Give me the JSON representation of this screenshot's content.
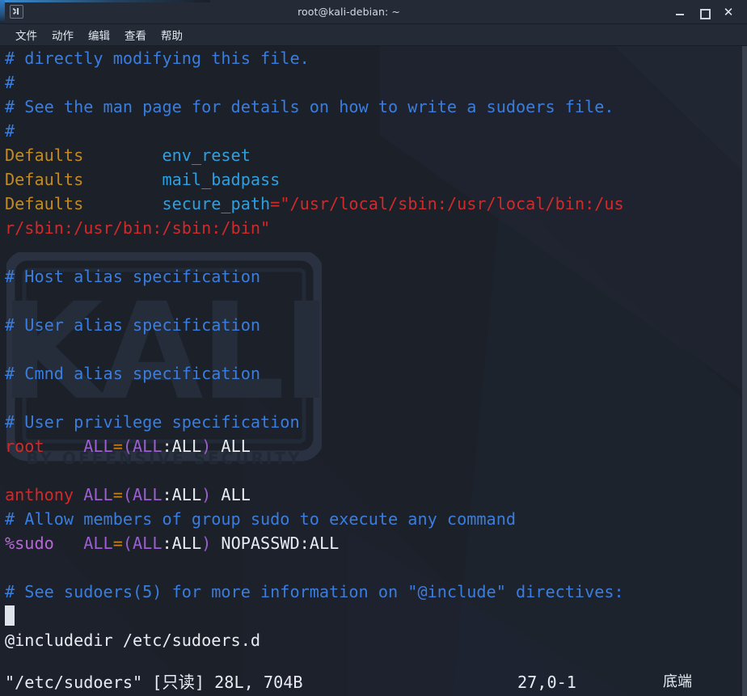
{
  "window": {
    "title": "root@kali-debian: ~",
    "icon": "terminal-icon",
    "controls": {
      "minimize": "—",
      "maximize": "□",
      "close": "✕"
    }
  },
  "menubar": {
    "items": [
      {
        "label": "文件"
      },
      {
        "label": "动作"
      },
      {
        "label": "编辑"
      },
      {
        "label": "查看"
      },
      {
        "label": "帮助"
      }
    ]
  },
  "terminal": {
    "watermark": "KALI",
    "watermark_sub": "BY OFFENSIVE SECURITY",
    "lines": [
      {
        "segments": [
          {
            "text": "# directly modifying this file.",
            "color": "comment"
          }
        ]
      },
      {
        "segments": [
          {
            "text": "#",
            "color": "comment"
          }
        ]
      },
      {
        "segments": [
          {
            "text": "# See the man page for details on how to write a sudoers file.",
            "color": "comment"
          }
        ]
      },
      {
        "segments": [
          {
            "text": "#",
            "color": "comment"
          }
        ]
      },
      {
        "segments": [
          {
            "text": "Defaults",
            "color": "keyword"
          },
          {
            "text": "        ",
            "color": "plain"
          },
          {
            "text": "env_reset",
            "color": "option"
          }
        ]
      },
      {
        "segments": [
          {
            "text": "Defaults",
            "color": "keyword"
          },
          {
            "text": "        ",
            "color": "plain"
          },
          {
            "text": "mail_badpass",
            "color": "option"
          }
        ]
      },
      {
        "segments": [
          {
            "text": "Defaults",
            "color": "keyword"
          },
          {
            "text": "        ",
            "color": "plain"
          },
          {
            "text": "secure_path",
            "color": "option"
          },
          {
            "text": "=",
            "color": "op"
          },
          {
            "text": "\"/usr/local/sbin:/usr/local/bin:/us",
            "color": "string"
          }
        ]
      },
      {
        "segments": [
          {
            "text": "r/sbin:/usr/bin:/sbin:/bin\"",
            "color": "string"
          }
        ]
      },
      {
        "segments": [
          {
            "text": "",
            "color": "plain"
          }
        ]
      },
      {
        "segments": [
          {
            "text": "# Host alias specification",
            "color": "comment"
          }
        ]
      },
      {
        "segments": [
          {
            "text": "",
            "color": "plain"
          }
        ]
      },
      {
        "segments": [
          {
            "text": "# User alias specification",
            "color": "comment"
          }
        ]
      },
      {
        "segments": [
          {
            "text": "",
            "color": "plain"
          }
        ]
      },
      {
        "segments": [
          {
            "text": "# Cmnd alias specification",
            "color": "comment"
          }
        ]
      },
      {
        "segments": [
          {
            "text": "",
            "color": "plain"
          }
        ]
      },
      {
        "segments": [
          {
            "text": "# User privilege specification",
            "color": "comment"
          }
        ]
      },
      {
        "segments": [
          {
            "text": "root",
            "color": "user"
          },
          {
            "text": "    ",
            "color": "plain"
          },
          {
            "text": "ALL",
            "color": "all"
          },
          {
            "text": "=",
            "color": "eq"
          },
          {
            "text": "(ALL",
            "color": "all"
          },
          {
            "text": ":ALL",
            "color": "plain"
          },
          {
            "text": ")",
            "color": "all"
          },
          {
            "text": " ALL",
            "color": "plain"
          }
        ]
      },
      {
        "segments": [
          {
            "text": "",
            "color": "plain"
          }
        ]
      },
      {
        "segments": [
          {
            "text": "anthony",
            "color": "user"
          },
          {
            "text": " ",
            "color": "plain"
          },
          {
            "text": "ALL",
            "color": "all"
          },
          {
            "text": "=",
            "color": "eq"
          },
          {
            "text": "(ALL",
            "color": "all"
          },
          {
            "text": ":ALL",
            "color": "plain"
          },
          {
            "text": ")",
            "color": "all"
          },
          {
            "text": " ALL",
            "color": "plain"
          }
        ]
      },
      {
        "segments": [
          {
            "text": "# Allow members of group sudo to execute any command",
            "color": "comment"
          }
        ]
      },
      {
        "segments": [
          {
            "text": "%sudo",
            "color": "group"
          },
          {
            "text": "   ",
            "color": "plain"
          },
          {
            "text": "ALL",
            "color": "all"
          },
          {
            "text": "=",
            "color": "eq"
          },
          {
            "text": "(ALL",
            "color": "all"
          },
          {
            "text": ":ALL",
            "color": "plain"
          },
          {
            "text": ")",
            "color": "all"
          },
          {
            "text": " NOPASSWD:ALL",
            "color": "plain"
          }
        ]
      },
      {
        "segments": [
          {
            "text": "",
            "color": "plain"
          }
        ]
      },
      {
        "segments": [
          {
            "text": "# See sudoers(5) for more information on \"@include\" directives:",
            "color": "comment"
          }
        ]
      },
      {
        "segments": [
          {
            "text": "",
            "color": "plain"
          },
          {
            "cursor": true
          }
        ]
      },
      {
        "segments": [
          {
            "text": "@includedir /etc/sudoers.d",
            "color": "plain"
          }
        ]
      }
    ],
    "status": {
      "file": "\"/etc/sudoers\" [只读] 28L, 704B",
      "position": "27,0-1",
      "state": "底端"
    }
  },
  "colors": {
    "background": "#1b2029",
    "titlebar": "#242a36",
    "comment": "#3b7ddd",
    "keyword": "#c38b1f",
    "option": "#2f9fe0",
    "string": "#d02b2b",
    "user": "#d02b2b",
    "group": "#b868d6",
    "all": "#9b5fd0",
    "plain": "#e8ecf2",
    "accent": "#3b8fd6"
  }
}
